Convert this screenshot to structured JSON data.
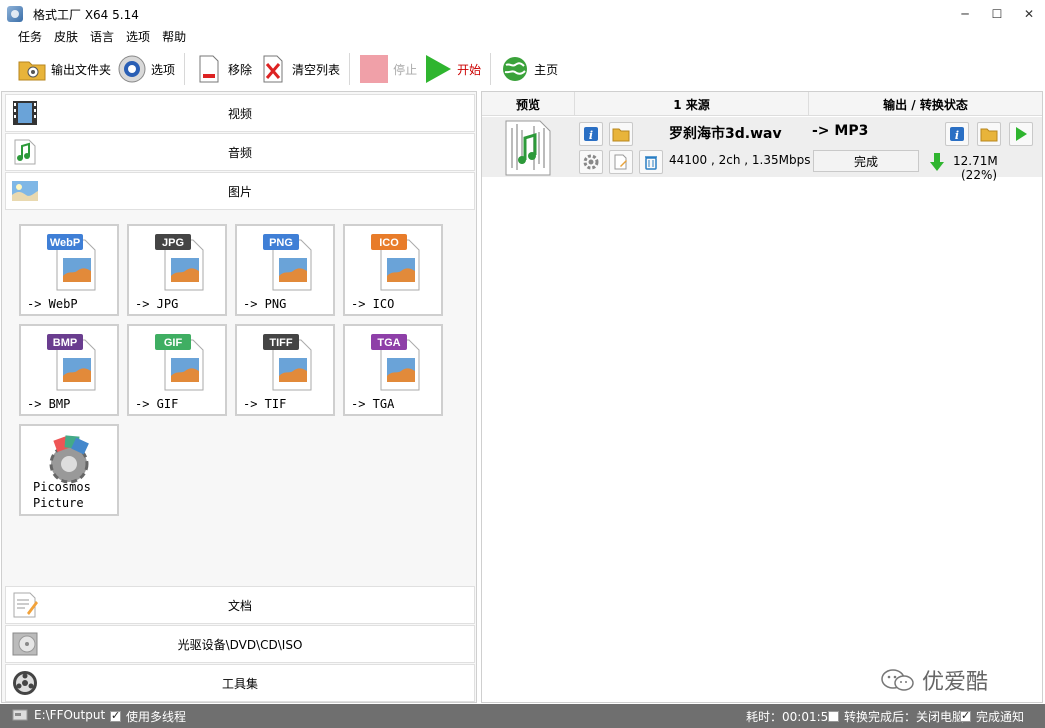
{
  "window": {
    "title": "格式工厂 X64 5.14",
    "minimize": "─",
    "maximize": "☐",
    "close": "✕"
  },
  "menu": [
    "任务",
    "皮肤",
    "语言",
    "选项",
    "帮助"
  ],
  "toolbar": {
    "output_folder": "输出文件夹",
    "options": "选项",
    "remove": "移除",
    "clear_list": "清空列表",
    "stop": "停止",
    "start": "开始",
    "home": "主页"
  },
  "categories_top": [
    {
      "label": "视频",
      "icon": "video-icon"
    },
    {
      "label": "音频",
      "icon": "audio-icon"
    },
    {
      "label": "图片",
      "icon": "picture-icon"
    }
  ],
  "formats": [
    {
      "badge": "WebP",
      "label": "-> WebP",
      "color": "#3f7fd6"
    },
    {
      "badge": "JPG",
      "label": "-> JPG",
      "color": "#444444"
    },
    {
      "badge": "PNG",
      "label": "-> PNG",
      "color": "#3f7fd6"
    },
    {
      "badge": "ICO",
      "label": "-> ICO",
      "color": "#e87c2a"
    },
    {
      "badge": "BMP",
      "label": "-> BMP",
      "color": "#6a3d8f"
    },
    {
      "badge": "GIF",
      "label": "-> GIF",
      "color": "#3fae62"
    },
    {
      "badge": "TIFF",
      "label": "-> TIF",
      "color": "#444444"
    },
    {
      "badge": "TGA",
      "label": "-> TGA",
      "color": "#8e3fa8"
    }
  ],
  "picosmos": {
    "line1": "Picosmos",
    "line2": "Picture"
  },
  "categories_bottom": [
    {
      "label": "文档",
      "icon": "document-icon"
    },
    {
      "label": "光驱设备\\DVD\\CD\\ISO",
      "icon": "disc-icon"
    },
    {
      "label": "工具集",
      "icon": "tools-icon"
    }
  ],
  "task_list": {
    "headers": {
      "preview": "预览",
      "source": "1 来源",
      "output": "输出 / 转换状态"
    },
    "row": {
      "file_name": "罗刹海市3d.wav",
      "file_info": "44100 , 2ch , 1.35Mbps",
      "output_format": "-> MP3",
      "status": "完成",
      "size": "12.71M",
      "ratio": "(22%)"
    }
  },
  "statusbar": {
    "output_path": "E:\\FFOutput",
    "multithread": "使用多线程",
    "elapsed": "耗时：00:01:50",
    "after_convert": "转换完成后：关闭电脑",
    "notify": "完成通知"
  },
  "watermark": "优爱酷",
  "colors": {
    "accent_green": "#2fb52f",
    "statusbar": "#6f6f6f"
  }
}
